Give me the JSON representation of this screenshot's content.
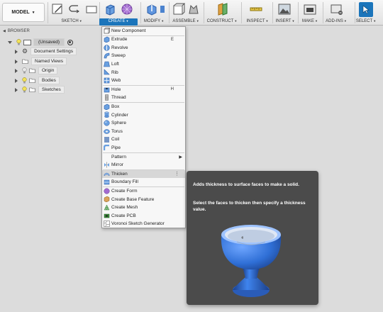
{
  "toolbar": {
    "workspace": "MODEL",
    "groups": [
      {
        "label": "SKETCH"
      },
      {
        "label": "CREATE"
      },
      {
        "label": "MODIFY"
      },
      {
        "label": "ASSEMBLE"
      },
      {
        "label": "CONSTRUCT"
      },
      {
        "label": "INSPECT"
      },
      {
        "label": "INSERT"
      },
      {
        "label": "MAKE"
      },
      {
        "label": "ADD-INS"
      },
      {
        "label": "SELECT"
      }
    ]
  },
  "browser": {
    "title": "BROWSER",
    "items": [
      {
        "label": "(Unsaved)"
      },
      {
        "label": "Document Settings"
      },
      {
        "label": "Named Views"
      },
      {
        "label": "Origin"
      },
      {
        "label": "Bodies"
      },
      {
        "label": "Sketches"
      }
    ]
  },
  "menu": {
    "items": [
      {
        "label": "New Component",
        "icon": "new-component-icon"
      },
      {
        "label": "Extrude",
        "shortcut": "E",
        "icon": "extrude-icon"
      },
      {
        "label": "Revolve",
        "icon": "revolve-icon"
      },
      {
        "label": "Sweep",
        "icon": "sweep-icon"
      },
      {
        "label": "Loft",
        "icon": "loft-icon"
      },
      {
        "label": "Rib",
        "icon": "rib-icon"
      },
      {
        "label": "Web",
        "icon": "web-icon"
      },
      {
        "label": "Hole",
        "shortcut": "H",
        "icon": "hole-icon"
      },
      {
        "label": "Thread",
        "icon": "thread-icon"
      },
      {
        "label": "Box",
        "icon": "box-icon"
      },
      {
        "label": "Cylinder",
        "icon": "cylinder-icon"
      },
      {
        "label": "Sphere",
        "icon": "sphere-icon"
      },
      {
        "label": "Torus",
        "icon": "torus-icon"
      },
      {
        "label": "Coil",
        "icon": "coil-icon"
      },
      {
        "label": "Pipe",
        "icon": "pipe-icon"
      },
      {
        "label": "Pattern",
        "icon": "pattern-icon"
      },
      {
        "label": "Mirror",
        "icon": "mirror-icon"
      },
      {
        "label": "Thicken",
        "icon": "thicken-icon"
      },
      {
        "label": "Boundary Fill",
        "icon": "boundary-fill-icon"
      },
      {
        "label": "Create Form",
        "icon": "create-form-icon"
      },
      {
        "label": "Create Base Feature",
        "icon": "create-base-feature-icon"
      },
      {
        "label": "Create Mesh",
        "icon": "create-mesh-icon"
      },
      {
        "label": "Create PCB",
        "icon": "create-pcb-icon"
      },
      {
        "label": "Voronoi Sketch Generator",
        "icon": "voronoi-icon"
      }
    ]
  },
  "tooltip": {
    "line1": "Adds thickness to surface faces to make a solid.",
    "line2": "Select the faces to thicken then specify a thickness value."
  },
  "colors": {
    "accent": "#1b75bb",
    "tooltip_bg": "#4b4b4b",
    "vase": "#2f6fd6"
  }
}
